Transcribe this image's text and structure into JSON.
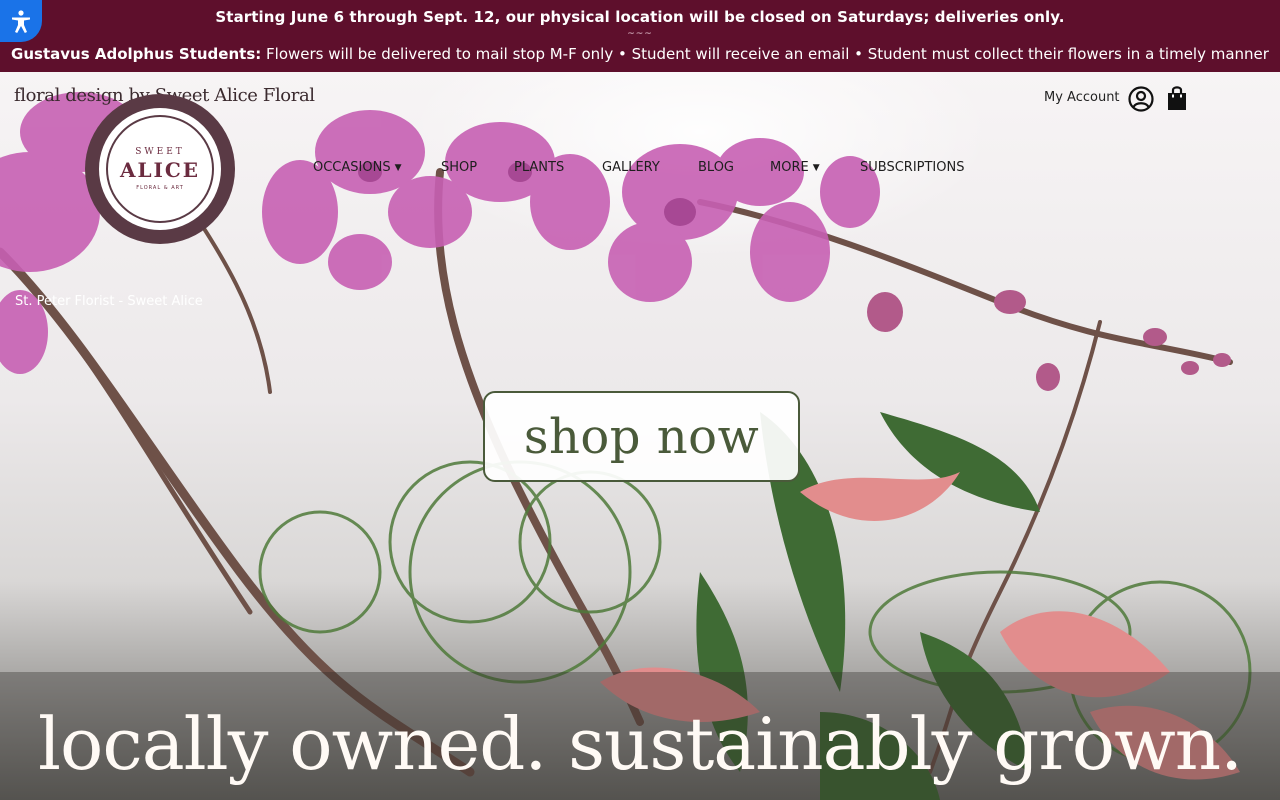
{
  "announcement": {
    "line1": "Starting June 6 through Sept. 12, our physical location will be closed on Saturdays; deliveries only.",
    "divider": "~~~",
    "line2_bold": "Gustavus Adolphus Students:",
    "line2_rest": " Flowers will be delivered to mail stop M-F only • Student will receive an email • Student must collect their flowers in a timely manner",
    "bg_color": "#5e0f2c"
  },
  "accessibility": {
    "icon": "accessibility-icon",
    "color": "#1a73e8"
  },
  "brand": {
    "tagline_text": "floral design by Sweet Alice Floral",
    "logo": {
      "top": "SWEET",
      "main": "ALICE",
      "sub": "FLORAL & ART"
    }
  },
  "header": {
    "account_label": "My Account",
    "account_icon": "user-circle-icon",
    "cart_icon": "shopping-bag-icon"
  },
  "nav": {
    "items": [
      {
        "label": "OCCASIONS",
        "dropdown": true
      },
      {
        "label": "SHOP",
        "dropdown": false
      },
      {
        "label": "PLANTS",
        "dropdown": false
      },
      {
        "label": "GALLERY",
        "dropdown": false
      },
      {
        "label": "BLOG",
        "dropdown": false
      },
      {
        "label": "MORE",
        "dropdown": true
      },
      {
        "label": "SUBSCRIPTIONS",
        "dropdown": false
      }
    ],
    "caret": "▼"
  },
  "hero": {
    "seo_text": "St. Peter Florist - Sweet Alice",
    "cta_label": "shop now",
    "headline": "locally owned. sustainably grown."
  }
}
